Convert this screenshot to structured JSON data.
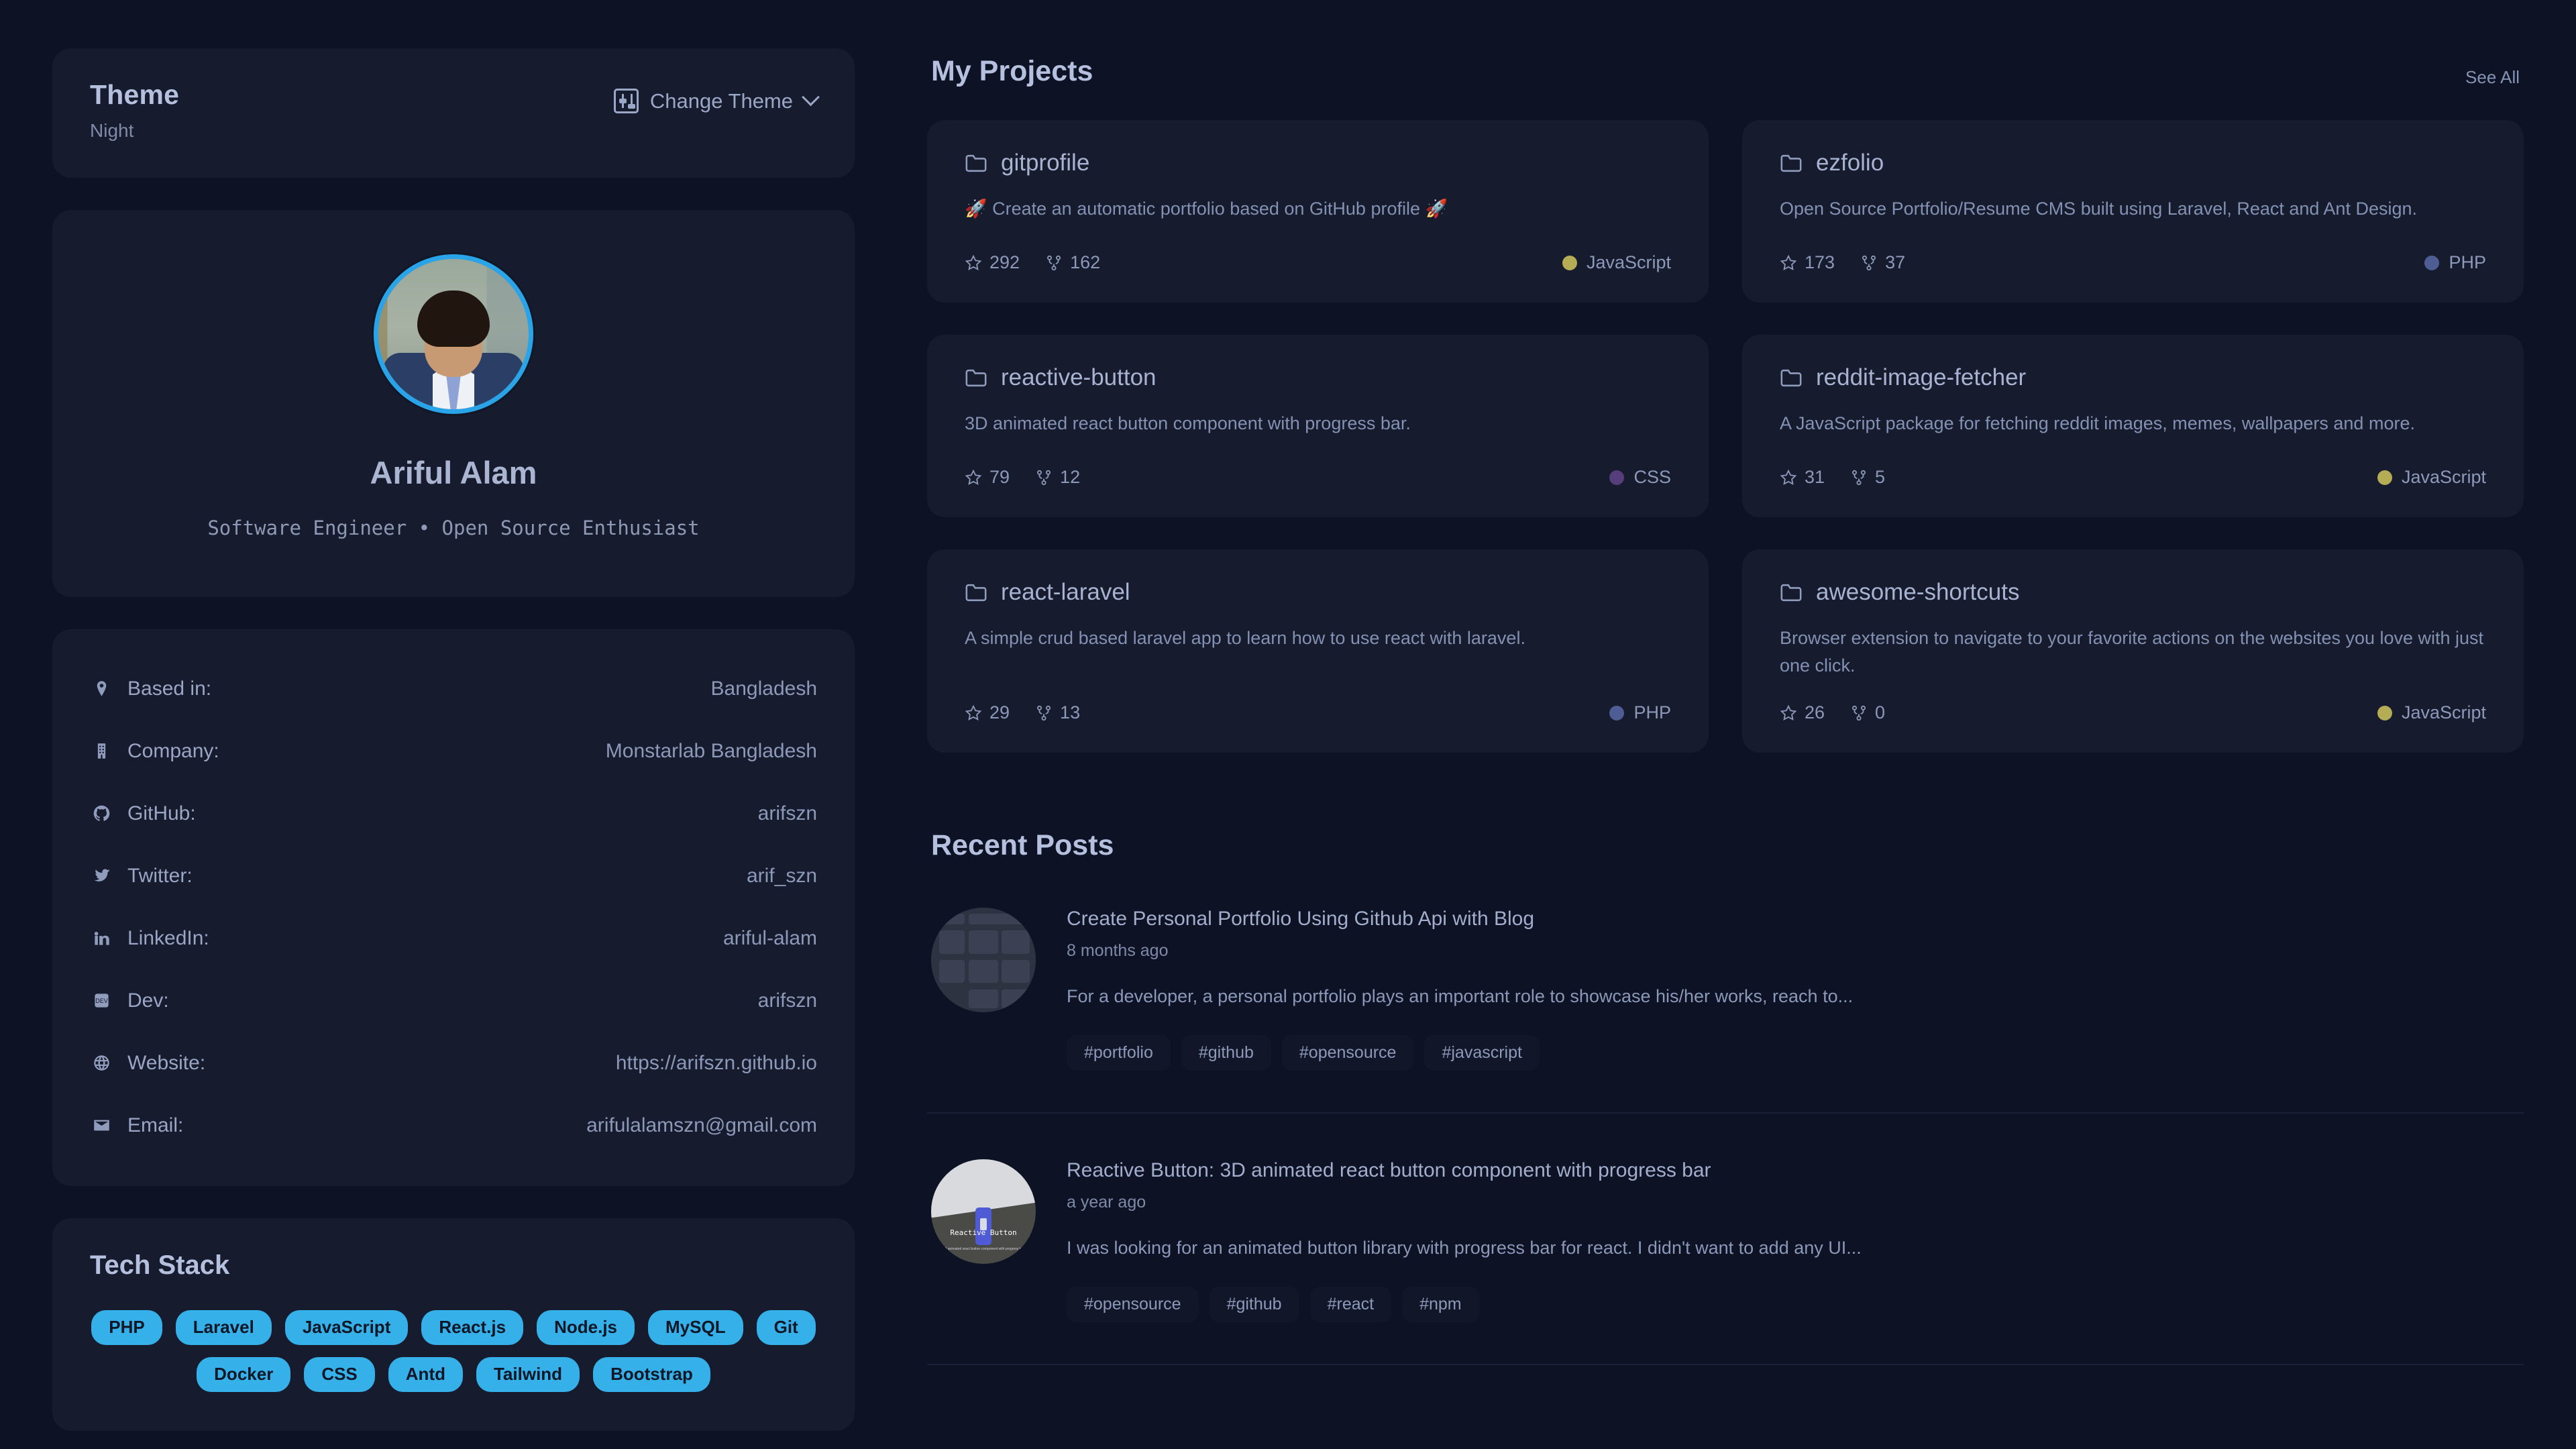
{
  "theme": {
    "title": "Theme",
    "current": "Night",
    "change_label": "Change Theme",
    "icon": "sliders-icon",
    "chevron": "chevron-down-icon"
  },
  "profile": {
    "avatar_alt": "avatar",
    "name": "Ariful Alam",
    "role": "Software Engineer • Open Source Enthusiast"
  },
  "details": [
    {
      "icon": "map-pin-icon",
      "label": "Based in:",
      "value": "Bangladesh"
    },
    {
      "icon": "building-icon",
      "label": "Company:",
      "value": "Monstarlab Bangladesh"
    },
    {
      "icon": "github-icon",
      "label": "GitHub:",
      "value": "arifszn"
    },
    {
      "icon": "twitter-icon",
      "label": "Twitter:",
      "value": "arif_szn"
    },
    {
      "icon": "linkedin-icon",
      "label": "LinkedIn:",
      "value": "ariful-alam"
    },
    {
      "icon": "dev-icon",
      "label": "Dev:",
      "value": "arifszn"
    },
    {
      "icon": "globe-icon",
      "label": "Website:",
      "value": "https://arifszn.github.io"
    },
    {
      "icon": "mail-icon",
      "label": "Email:",
      "value": "arifulalamszn@gmail.com"
    }
  ],
  "tech_stack": {
    "title": "Tech Stack",
    "chip_color": "#36b0e8",
    "items": [
      "PHP",
      "Laravel",
      "JavaScript",
      "React.js",
      "Node.js",
      "MySQL",
      "Git",
      "Docker",
      "CSS",
      "Antd",
      "Tailwind",
      "Bootstrap"
    ]
  },
  "projects": {
    "title": "My Projects",
    "see_all": "See All",
    "items": [
      {
        "name": "gitprofile",
        "description": "🚀 Create an automatic portfolio based on GitHub profile 🚀",
        "stars": "292",
        "forks": "162",
        "language": "JavaScript",
        "language_color": "#b5ac56"
      },
      {
        "name": "ezfolio",
        "description": "Open Source Portfolio/Resume CMS built using Laravel, React and Ant Design.",
        "stars": "173",
        "forks": "37",
        "language": "PHP",
        "language_color": "#4f5d95"
      },
      {
        "name": "reactive-button",
        "description": "3D animated react button component with progress bar.",
        "stars": "79",
        "forks": "12",
        "language": "CSS",
        "language_color": "#563d7c"
      },
      {
        "name": "reddit-image-fetcher",
        "description": "A JavaScript package for fetching reddit images, memes, wallpapers and more.",
        "stars": "31",
        "forks": "5",
        "language": "JavaScript",
        "language_color": "#b5ac56"
      },
      {
        "name": "react-laravel",
        "description": "A simple crud based laravel app to learn how to use react with laravel.",
        "stars": "29",
        "forks": "13",
        "language": "PHP",
        "language_color": "#4f5d95"
      },
      {
        "name": "awesome-shortcuts",
        "description": "Browser extension to navigate to your favorite actions on the websites you love with just one click.",
        "stars": "26",
        "forks": "0",
        "language": "JavaScript",
        "language_color": "#b5ac56"
      }
    ]
  },
  "recent_posts": {
    "title": "Recent Posts",
    "items": [
      {
        "thumbnail": "portfolio-screenshot-thumbnail",
        "title": "Create Personal Portfolio Using Github Api with Blog",
        "date": "8 months ago",
        "excerpt": "For a developer, a personal portfolio plays an important role to showcase his/her works, reach to...",
        "tags": [
          "#portfolio",
          "#github",
          "#opensource",
          "#javascript"
        ]
      },
      {
        "thumbnail": "reactive-button-thumbnail",
        "thumbnail_label": "Reactive Button",
        "thumbnail_sub": "3D animated react button component with progress bar",
        "title": "Reactive Button: 3D animated react button component with progress bar",
        "date": "a year ago",
        "excerpt": "I was looking for an animated button library with progress bar for react. I didn't want to add any UI...",
        "tags": [
          "#opensource",
          "#github",
          "#react",
          "#npm"
        ]
      }
    ]
  }
}
